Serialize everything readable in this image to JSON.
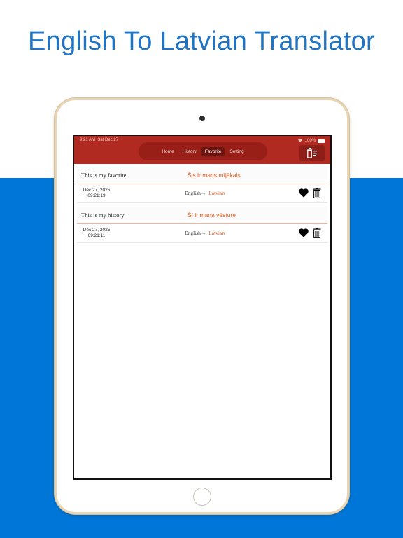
{
  "headline": "English To Latvian Translator",
  "status_bar": {
    "time": "9:21 AM",
    "date": "Sat Dec 27",
    "battery": "100%"
  },
  "tabs": [
    {
      "label": "Home",
      "active": false
    },
    {
      "label": "History",
      "active": false
    },
    {
      "label": "Favorite",
      "active": true
    },
    {
      "label": "Setting",
      "active": false
    }
  ],
  "entries": [
    {
      "source": "This is my favorite",
      "target": "Šis ir mans mīļākais",
      "date": "Dec 27, 2025",
      "time": "09:21:19",
      "from_lang": "English",
      "arrow": "→",
      "to_lang": "Latvian"
    },
    {
      "source": "This is my history",
      "target": "Šī ir mana vēsture",
      "date": "Dec 27, 2025",
      "time": "09:21:11",
      "from_lang": "English",
      "arrow": "→",
      "to_lang": "Latvian"
    }
  ],
  "colors": {
    "nav": "#b02a21",
    "accent": "#ef5a1c",
    "background_band": "#0077d8",
    "headline": "#1f74c4"
  },
  "icons": {
    "clear_all": "trash-list-icon",
    "favorite": "heart-icon",
    "delete": "trash-icon"
  }
}
